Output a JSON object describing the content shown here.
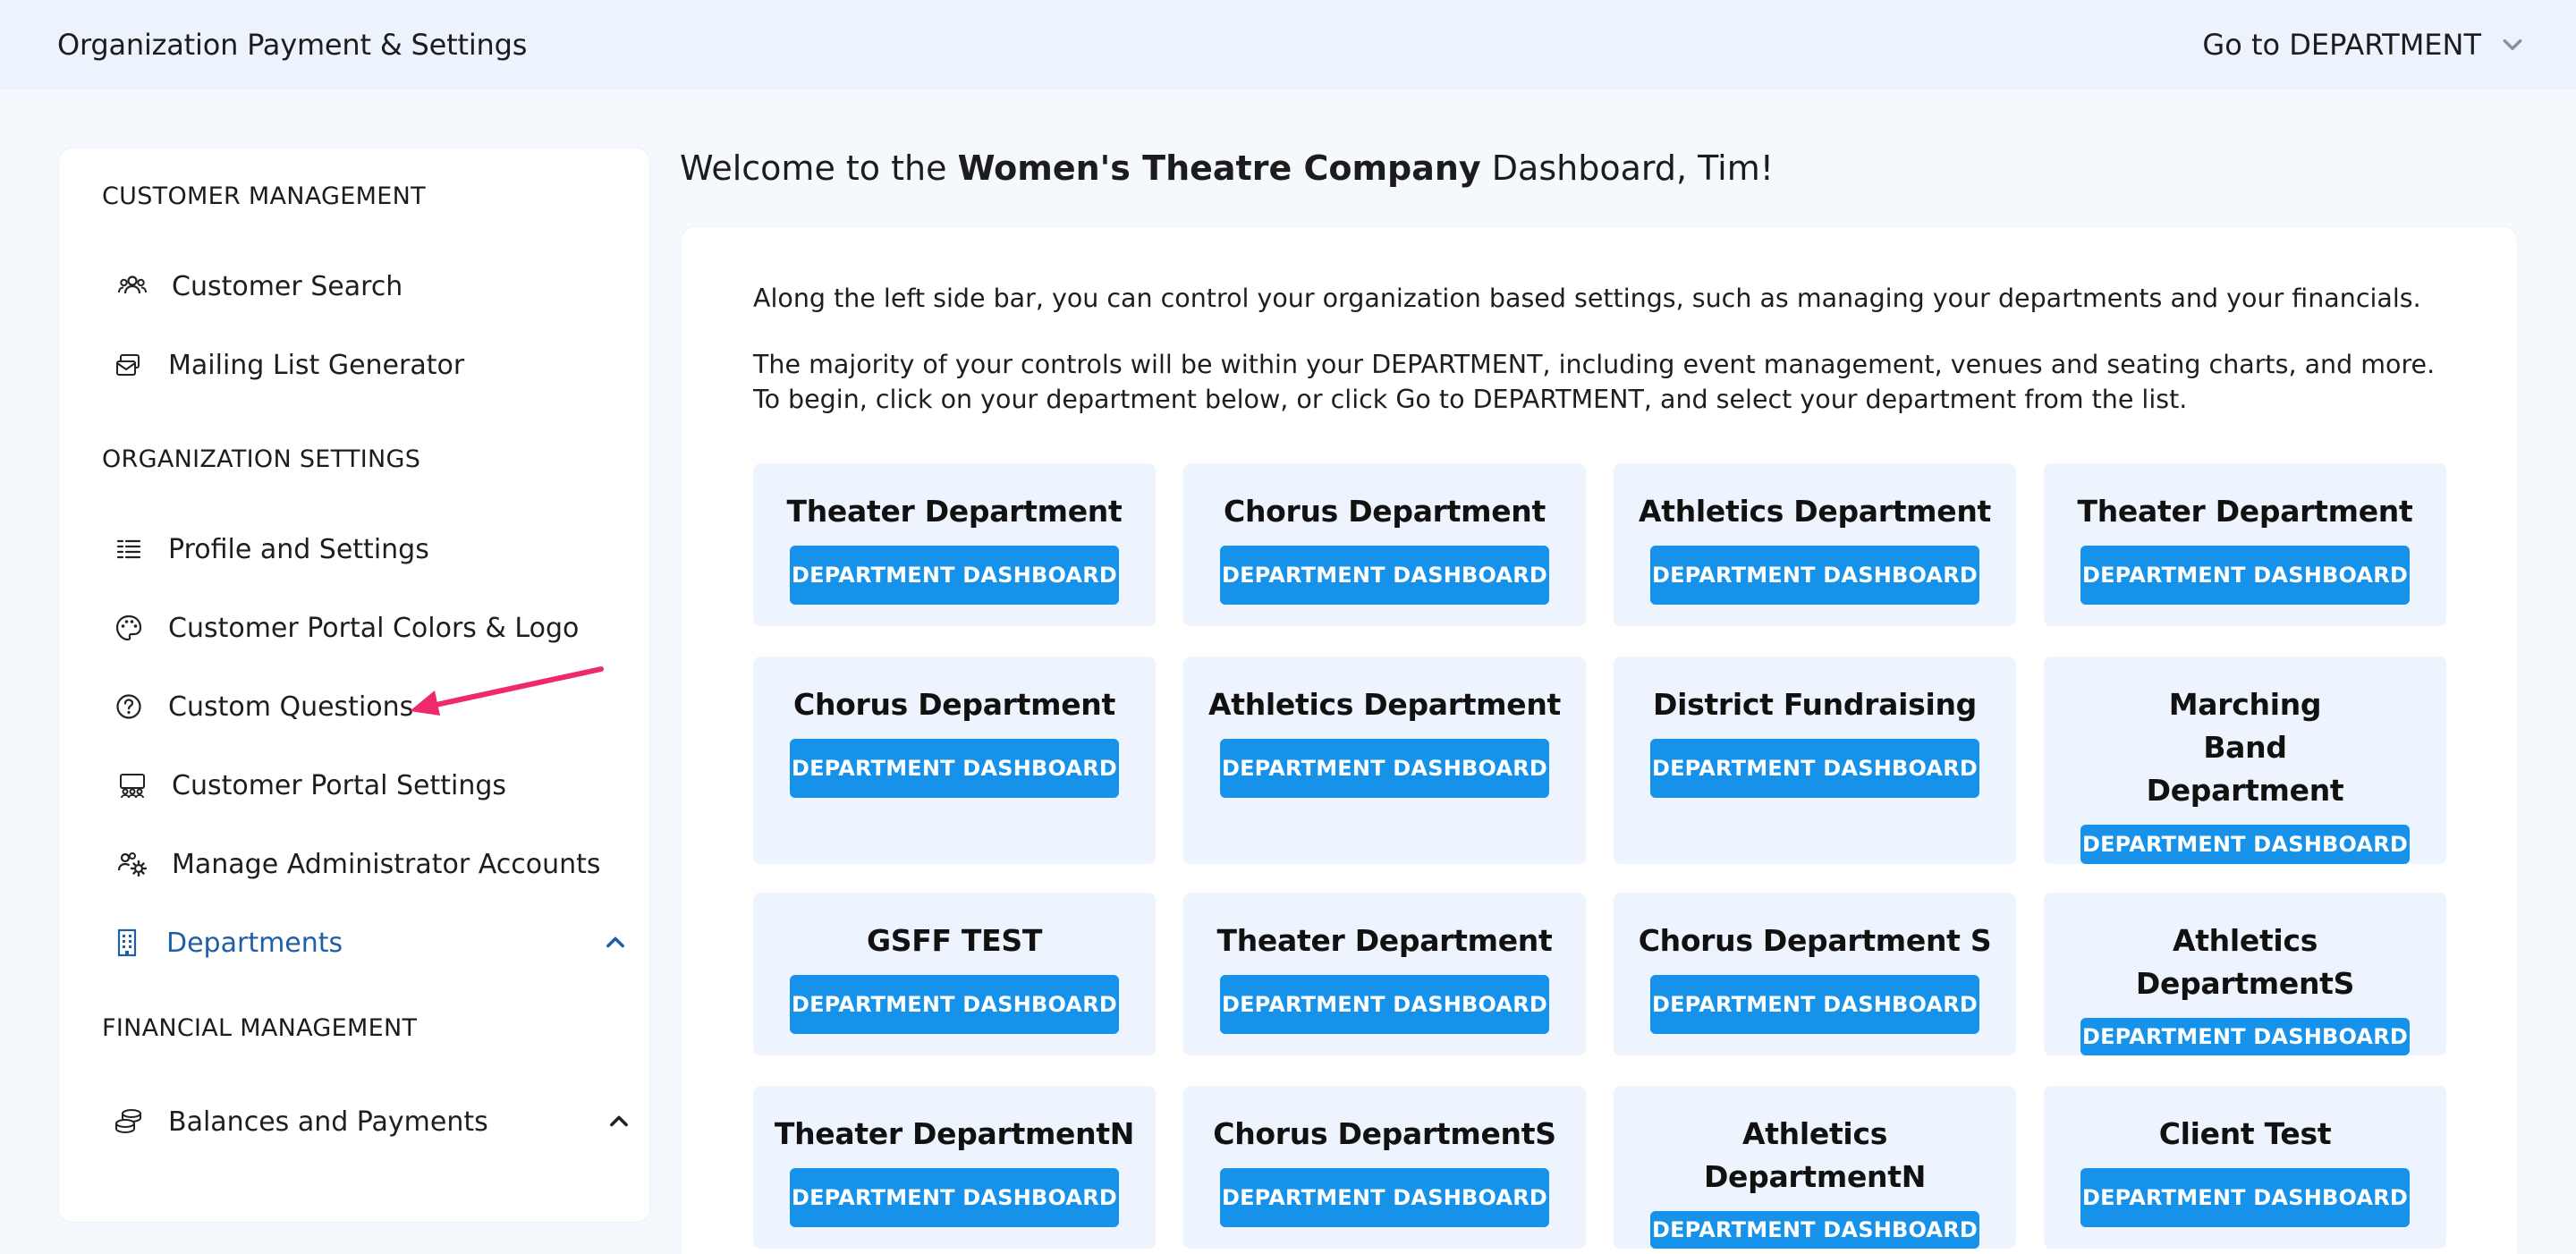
{
  "header": {
    "title": "Organization Payment & Settings",
    "dept_selector": "Go to DEPARTMENT"
  },
  "sidebar": {
    "sections": {
      "customer": "CUSTOMER MANAGEMENT",
      "org": "ORGANIZATION SETTINGS",
      "financial": "FINANCIAL MANAGEMENT"
    },
    "items": {
      "customer_search": "Customer Search",
      "mailing_list": "Mailing List Generator",
      "profile": "Profile and Settings",
      "portal_colors": "Customer Portal Colors & Logo",
      "custom_questions": "Custom Questions",
      "portal_settings": "Customer Portal Settings",
      "admin_accounts": "Manage Administrator Accounts",
      "departments": "Departments",
      "balances": "Balances and Payments"
    }
  },
  "main": {
    "welcome_prefix": "Welcome to the ",
    "org_name": "Women's Theatre Company",
    "welcome_suffix": " Dashboard, Tim!",
    "intro1": "Along the left side bar, you can control your organization based settings, such as managing your departments and your financials.",
    "intro2": "The majority of your controls will be within your DEPARTMENT, including event management, venues and seating charts, and more. To begin, click on your department below, or click Go to DEPARTMENT, and select your department from the list.",
    "button_label": "DEPARTMENT DASHBOARD",
    "departments": [
      "Theater Department",
      "Chorus Department",
      "Athletics Department",
      "Theater Department",
      "Chorus Department",
      "Athletics Department",
      "District Fundraising",
      "Marching Band Department",
      "GSFF TEST",
      "Theater Department",
      "Chorus Department S",
      "Athletics DepartmentS",
      "Theater DepartmentN",
      "Chorus DepartmentS",
      "Athletics DepartmentN",
      "Client Test"
    ]
  },
  "colors": {
    "accent": "#1692ea",
    "active_nav": "#1d5fa8",
    "annotation_arrow": "#ee2a6b"
  }
}
